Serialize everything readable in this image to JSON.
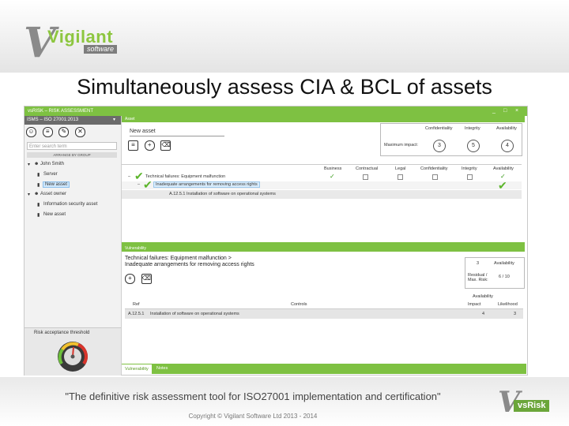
{
  "logo": {
    "brand": "Vigilant",
    "sub": "software"
  },
  "slide_title": "Simultaneously assess CIA & BCL of assets",
  "app": {
    "window_title": "vsRISK – RISK ASSESSMENT",
    "min_glyph": "_",
    "max_glyph": "□",
    "close_glyph": "×",
    "left": {
      "standard": "ISMS – ISO 27001:2013",
      "standard_dropdown": "▾",
      "search_placeholder": "Enter search term",
      "group_header": "ARRANGE BY GROUP",
      "tree": [
        {
          "label": "John Smith",
          "type": "owner"
        },
        {
          "label": "Server",
          "type": "asset"
        },
        {
          "label": "New asset",
          "type": "asset",
          "selected": true
        },
        {
          "label": "Asset owner",
          "type": "owner"
        },
        {
          "label": "Information security asset",
          "type": "asset"
        },
        {
          "label": "New asset",
          "type": "asset"
        }
      ],
      "risk_threshold_label": "Risk acceptance threshold"
    },
    "asset": {
      "panel_title": "Asset",
      "name": "New asset",
      "cia": {
        "headers": [
          "Confidentiality",
          "Integrity",
          "Availability"
        ],
        "row_label": "Maximum impact:",
        "values": [
          "3",
          "5",
          "4"
        ]
      },
      "grid_headers": [
        "Business",
        "Contractual",
        "Legal",
        "Confidentiality",
        "Integrity",
        "Availability"
      ],
      "threat": "Technical failures: Equipment malfunction",
      "vulnerability": "Inadequate arrangements for removing access rights",
      "control": "A.12.5.1   Installation of software on operational systems"
    },
    "vuln": {
      "panel_title": "Vulnerability",
      "line1": "Technical failures: Equipment malfunction >",
      "line2": "Inadequate arrangements for removing access rights",
      "box": {
        "value_top": "3",
        "availability": "Availability",
        "residual_label": "Residual / Max. Risk:",
        "residual_value": "6 / 10"
      },
      "table_group_header": "Availability",
      "headers": [
        "Ref",
        "Controls",
        "Impact",
        "Likelihood"
      ],
      "row": {
        "ref": "A.12.5.1",
        "control": "Installation of software on operational systems",
        "impact": "4",
        "likelihood": "3"
      }
    },
    "tabs": [
      {
        "label": "Vulnerability",
        "active": true
      },
      {
        "label": "Notes",
        "active": false
      }
    ]
  },
  "footer": {
    "quote": "\"The definitive risk assessment tool for ISO27001 implementation and certification\"",
    "copyright": "Copyright © Vigilant Software Ltd 2013 - 2014",
    "vsrisk_badge": "vsRisk"
  },
  "colors": {
    "accent": "#7ec142",
    "gauge_red": "#d9342b",
    "gauge_yellow": "#f2c12e",
    "gauge_green": "#6cbf3a"
  }
}
